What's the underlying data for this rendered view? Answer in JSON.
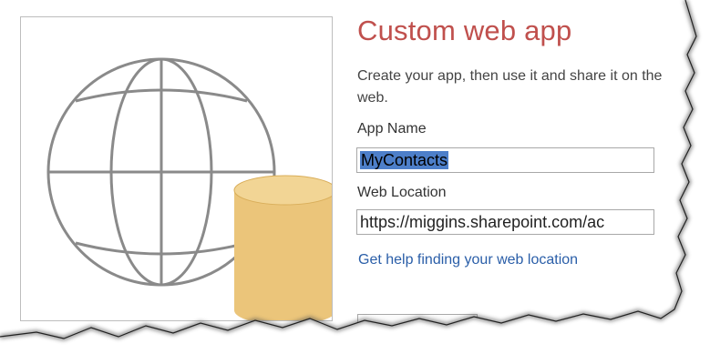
{
  "app": {
    "title": "Custom web app",
    "description_lines": [
      "Create your app, then use it and share it on the",
      "web."
    ]
  },
  "form": {
    "app_name_label": "App Name",
    "app_name_value": "MyContacts",
    "web_location_label": "Web Location",
    "web_location_value": "https://miggins.sharepoint.com/ac",
    "help_link": "Get help finding your web location"
  },
  "icons": {
    "preview": "globe-with-database-icon"
  },
  "colors": {
    "title": "#c0504d",
    "link": "#2a5ea8",
    "selection": "#4d7fc9",
    "database": "#ebc57a"
  }
}
